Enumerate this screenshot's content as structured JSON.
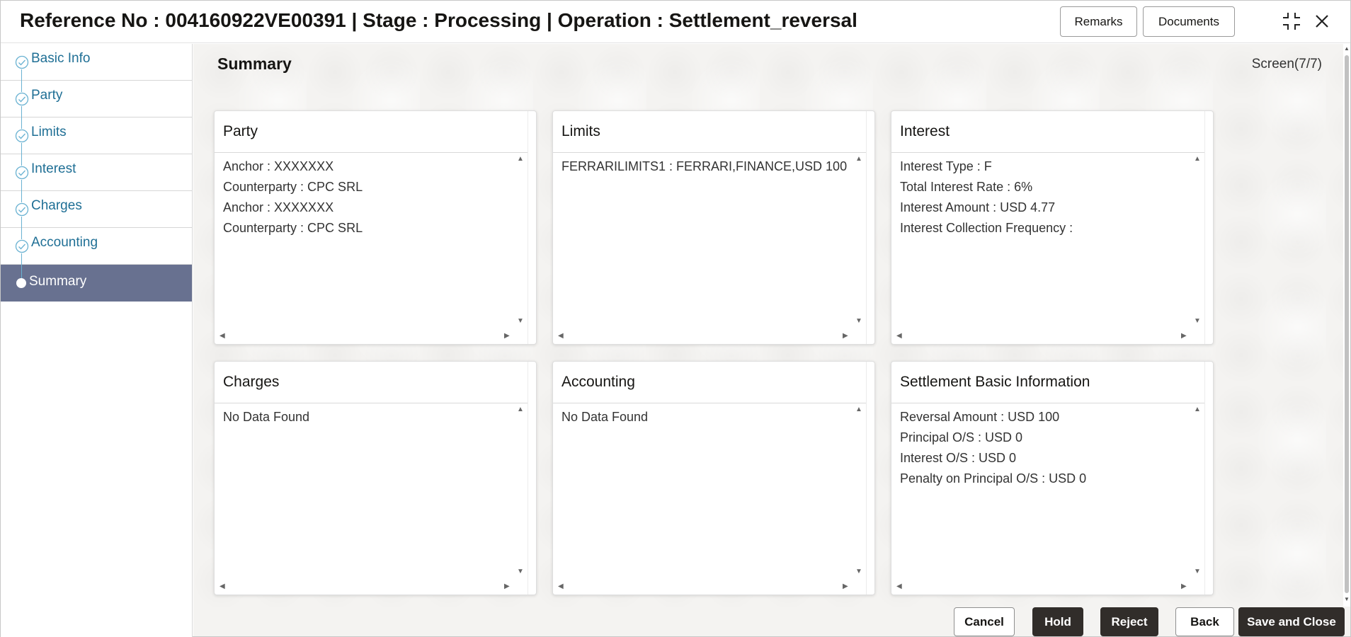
{
  "header": {
    "title": "Reference No : 004160922VE00391 | Stage : Processing | Operation : Settlement_reversal",
    "remarks_label": "Remarks",
    "documents_label": "Documents"
  },
  "sidebar": {
    "items": [
      {
        "label": "Basic Info",
        "state": "done"
      },
      {
        "label": "Party",
        "state": "done"
      },
      {
        "label": "Limits",
        "state": "done"
      },
      {
        "label": "Interest",
        "state": "done"
      },
      {
        "label": "Charges",
        "state": "done"
      },
      {
        "label": "Accounting",
        "state": "done"
      },
      {
        "label": "Summary",
        "state": "active"
      }
    ]
  },
  "main": {
    "heading": "Summary",
    "screen_indicator": "Screen(7/7)",
    "cards": [
      {
        "title": "Party",
        "lines": [
          "Anchor : XXXXXXX",
          "Counterparty : CPC SRL",
          "Anchor : XXXXXXX",
          "Counterparty : CPC SRL"
        ]
      },
      {
        "title": "Limits",
        "lines": [
          "FERRARILIMITS1 : FERRARI,FINANCE,USD 100"
        ]
      },
      {
        "title": "Interest",
        "lines": [
          "Interest Type : F",
          "Total Interest Rate : 6%",
          "Interest Amount : USD 4.77",
          "Interest Collection Frequency :"
        ]
      },
      {
        "title": "Charges",
        "lines": [
          "No Data Found"
        ]
      },
      {
        "title": "Accounting",
        "lines": [
          "No Data Found"
        ]
      },
      {
        "title": "Settlement Basic Information",
        "lines": [
          "Reversal Amount : USD 100",
          "Principal O/S : USD 0",
          "Interest O/S : USD 0",
          "Penalty on Principal O/S : USD 0"
        ]
      }
    ]
  },
  "footer": {
    "cancel_label": "Cancel",
    "hold_label": "Hold",
    "reject_label": "Reject",
    "back_label": "Back",
    "save_close_label": "Save and Close"
  },
  "colors": {
    "accent_link": "#1f6f95",
    "active_nav_bg": "#687190",
    "primary_button": "#312d2a"
  }
}
